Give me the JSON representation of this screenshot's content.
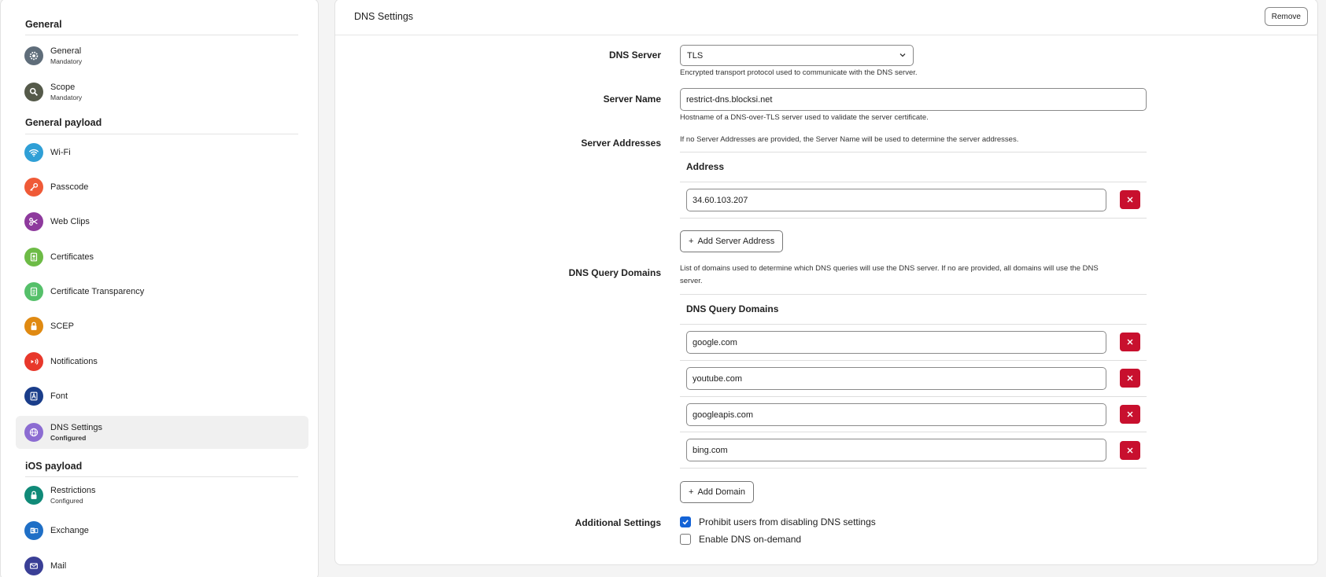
{
  "sidebar": {
    "sections": [
      {
        "title": "General"
      },
      {
        "title": "General payload"
      },
      {
        "title": "iOS payload"
      }
    ],
    "items": [
      {
        "label": "General",
        "sub": "Mandatory",
        "icon": "gear-icon",
        "color": "#5f6d7a"
      },
      {
        "label": "Scope",
        "sub": "Mandatory",
        "icon": "scope-icon",
        "color": "#555a4a"
      },
      {
        "label": "Wi-Fi",
        "sub": "",
        "icon": "wifi-icon",
        "color": "#2f9fd6"
      },
      {
        "label": "Passcode",
        "sub": "",
        "icon": "key-icon",
        "color": "#ef5a37"
      },
      {
        "label": "Web Clips",
        "sub": "",
        "icon": "scissors-icon",
        "color": "#8e3a9d"
      },
      {
        "label": "Certificates",
        "sub": "",
        "icon": "certificate-icon",
        "color": "#6dbb46"
      },
      {
        "label": "Certificate Transparency",
        "sub": "",
        "icon": "certificate-transparency-icon",
        "color": "#55c06a"
      },
      {
        "label": "SCEP",
        "sub": "",
        "icon": "lock-icon",
        "color": "#e08a12"
      },
      {
        "label": "Notifications",
        "sub": "",
        "icon": "notification-icon",
        "color": "#e8382b"
      },
      {
        "label": "Font",
        "sub": "",
        "icon": "font-icon",
        "color": "#1a3d8a"
      },
      {
        "label": "DNS Settings",
        "sub": "Configured",
        "icon": "globe-icon",
        "color": "#8c6cd2"
      },
      {
        "label": "Restrictions",
        "sub": "Configured",
        "icon": "restrictions-lock-icon",
        "color": "#108a78"
      },
      {
        "label": "Exchange",
        "sub": "",
        "icon": "exchange-icon",
        "color": "#1f6fc6"
      },
      {
        "label": "Mail",
        "sub": "",
        "icon": "mail-icon",
        "color": "#3a3f96"
      }
    ]
  },
  "main": {
    "title": "DNS Settings",
    "remove_label": "Remove",
    "dns_server": {
      "label": "DNS Server",
      "value": "TLS",
      "help": "Encrypted transport protocol used to communicate with the DNS server."
    },
    "server_name": {
      "label": "Server Name",
      "value": "restrict-dns.blocksi.net",
      "help": "Hostname of a DNS-over-TLS server used to validate the server certificate."
    },
    "server_addresses": {
      "label": "Server Addresses",
      "help": "If no Server Addresses are provided, the Server Name will be used to determine the server addresses.",
      "column": "Address",
      "rows": [
        "34.60.103.207"
      ],
      "add_label": "Add Server Address"
    },
    "query_domains": {
      "label": "DNS Query Domains",
      "help_line1": "List of domains used to determine which DNS queries will use the DNS server. If no are provided, all domains will use the DNS",
      "help_line2": "server.",
      "column": "DNS Query Domains",
      "rows": [
        "google.com",
        "youtube.com",
        "googleapis.com",
        "bing.com"
      ],
      "add_label": "Add Domain"
    },
    "additional": {
      "label": "Additional Settings",
      "options": [
        {
          "label": "Prohibit users from disabling DNS settings",
          "checked": true
        },
        {
          "label": "Enable DNS on-demand",
          "checked": false
        }
      ]
    }
  },
  "colors": {
    "danger": "#c8102e",
    "accent": "#1463d6"
  }
}
